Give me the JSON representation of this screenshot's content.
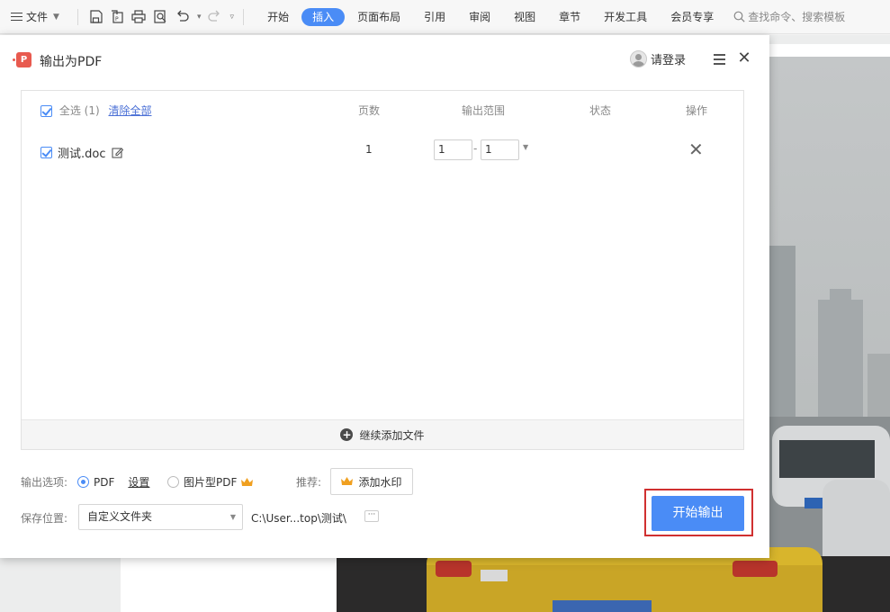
{
  "ribbon": {
    "file_menu": "文件",
    "tabs": [
      {
        "label": "开始"
      },
      {
        "label": "插入",
        "active": true
      },
      {
        "label": "页面布局"
      },
      {
        "label": "引用"
      },
      {
        "label": "审阅"
      },
      {
        "label": "视图"
      },
      {
        "label": "章节"
      },
      {
        "label": "开发工具"
      },
      {
        "label": "会员专享"
      }
    ],
    "search_placeholder": "查找命令、搜索模板",
    "accent": "#4a8cf6"
  },
  "dialog": {
    "title": "输出为PDF",
    "login": "请登录",
    "table": {
      "select_all": "全选 (1)",
      "clear_all": "清除全部",
      "col_pages": "页数",
      "col_range": "输出范围",
      "col_status": "状态",
      "col_action": "操作"
    },
    "files": [
      {
        "name": "测试.doc",
        "pages": "1",
        "range_from": "1",
        "range_to": "1",
        "status": ""
      }
    ],
    "add_more": "继续添加文件",
    "output_options_label": "输出选项:",
    "opt_pdf": "PDF",
    "opt_settings": "设置",
    "opt_image_pdf": "图片型PDF",
    "recommend_label": "推荐:",
    "watermark_button": "添加水印",
    "save_location_label": "保存位置:",
    "save_location_value": "自定义文件夹",
    "save_path": "C:\\User...top\\测试\\",
    "more_button": "···",
    "start_button": "开始输出",
    "highlight_color": "#d03030"
  }
}
